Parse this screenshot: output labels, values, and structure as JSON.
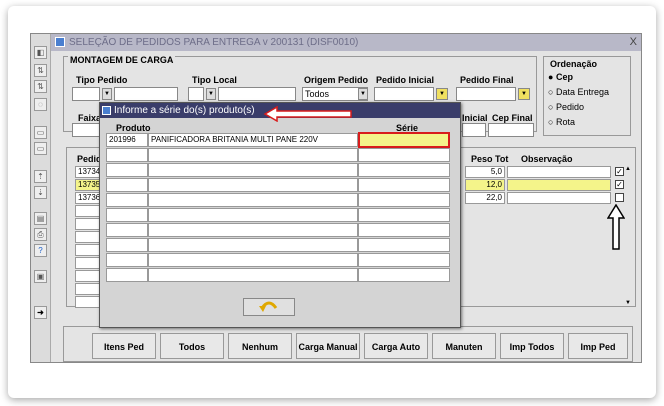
{
  "window": {
    "title": "SELEÇÃO DE PEDIDOS PARA ENTREGA v 200131 (DISF0010)",
    "close": "X"
  },
  "panel": {
    "title": "MONTAGEM DE CARGA",
    "tipo_pedido": "Tipo Pedido",
    "tipo_local": "Tipo Local",
    "origem_pedido": "Origem Pedido",
    "origem_value": "Todos",
    "pedido_inicial": "Pedido Inicial",
    "pedido_final": "Pedido Final",
    "faixa": "Faixa",
    "inicial": "Inicial",
    "cep_final": "Cep Final"
  },
  "ordenacao": {
    "title": "Ordenação",
    "options": [
      {
        "label": "Cep",
        "selected": true
      },
      {
        "label": "Data Entrega",
        "selected": false
      },
      {
        "label": "Pedido",
        "selected": false
      },
      {
        "label": "Rota",
        "selected": false
      }
    ]
  },
  "grid": {
    "headers": {
      "pedido": "Pedido",
      "peso_tot": "Peso Tot",
      "observacao": "Observação"
    },
    "rows": [
      {
        "pedido": "13734",
        "peso": "5,0",
        "checked": true,
        "highlight": false
      },
      {
        "pedido": "13735",
        "peso": "12,0",
        "checked": true,
        "highlight": true
      },
      {
        "pedido": "13736",
        "peso": "22,0",
        "checked": false,
        "highlight": false
      }
    ]
  },
  "buttons": [
    "Itens Ped",
    "Todos",
    "Nenhum",
    "Carga Manual",
    "Carga Auto",
    "Manuten",
    "Imp Todos",
    "Imp Ped"
  ],
  "dialog": {
    "title": "Informe a série do(s) produto(s)",
    "col_produto": "Produto",
    "col_serie": "Série",
    "rows": [
      {
        "codigo": "201996",
        "descricao": "PANIFICADORA BRITANIA MULTI PANE 220V",
        "serie": ""
      }
    ]
  },
  "colors": {
    "accent_red": "#d81c1c",
    "highlight_yellow": "#f4f48a",
    "dialog_title_bg": "#3a3d6a"
  }
}
